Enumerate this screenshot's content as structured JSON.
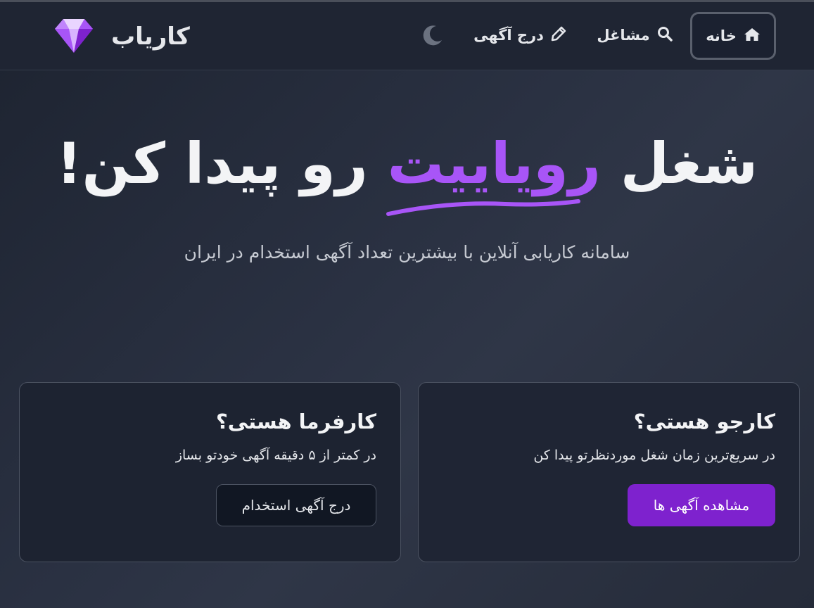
{
  "nav": {
    "brand": "کاریاب",
    "home_label": "خانه",
    "jobs_label": "مشاغل",
    "post_label": "درج آگهی",
    "theme_icon": "moon-icon",
    "brand_icon": "gem-icon"
  },
  "hero": {
    "title_start": "شغل ",
    "title_accent": "رویاییت",
    "title_end": " رو پیدا کن!",
    "subtitle": "سامانه کاریابی آنلاین با بیشترین تعداد آگهی استخدام در ایران"
  },
  "cards": {
    "seeker": {
      "title": "کارجو هستی؟",
      "text": "در سریع‌ترین زمان شغل موردنظرتو پیدا کن",
      "button": "مشاهده آگهی ها"
    },
    "employer": {
      "title": "کارفرما هستی؟",
      "text": "در کمتر از ۵ دقیقه آگهی خودتو بساز",
      "button": "درج آگهی استخدام"
    }
  },
  "colors": {
    "accent": "#a855f7",
    "primary_button": "#7e22ce",
    "background": "#2a3142"
  }
}
